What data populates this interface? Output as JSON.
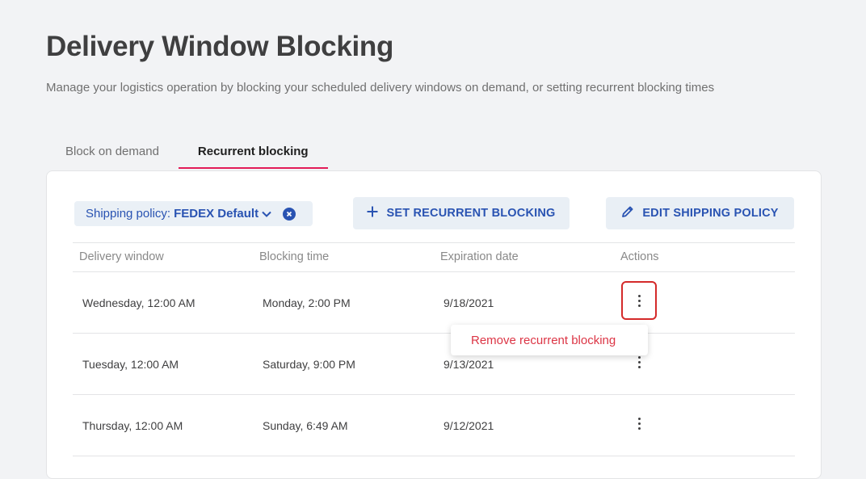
{
  "header": {
    "title": "Delivery Window Blocking",
    "subtitle": "Manage your logistics operation by blocking your scheduled delivery windows on demand, or setting recurrent blocking times"
  },
  "tabs": [
    {
      "label": "Block on demand",
      "active": false
    },
    {
      "label": "Recurrent blocking",
      "active": true
    }
  ],
  "filter": {
    "label": "Shipping policy:",
    "value": "FEDEX Default"
  },
  "actions": {
    "set_recurrent": "SET RECURRENT BLOCKING",
    "edit_policy": "EDIT SHIPPING POLICY"
  },
  "table": {
    "columns": [
      "Delivery window",
      "Blocking time",
      "Expiration date",
      "Actions"
    ],
    "rows": [
      {
        "delivery_window": "Wednesday, 12:00 AM",
        "blocking_time": "Monday, 2:00 PM",
        "expiration": "9/18/2021"
      },
      {
        "delivery_window": "Tuesday, 12:00 AM",
        "blocking_time": "Saturday, 9:00 PM",
        "expiration": "9/13/2021"
      },
      {
        "delivery_window": "Thursday, 12:00 AM",
        "blocking_time": "Sunday, 6:49 AM",
        "expiration": "9/12/2021"
      }
    ]
  },
  "menu": {
    "remove_label": "Remove recurrent blocking"
  },
  "colors": {
    "accent_tab": "#e31c58",
    "primary_blue": "#2953b2",
    "danger": "#dc3545",
    "focus_border": "#d42a2a"
  },
  "icons": [
    "chevron-down-icon",
    "clear-filter-icon",
    "plus-icon",
    "pencil-icon",
    "kebab-menu-icon"
  ]
}
